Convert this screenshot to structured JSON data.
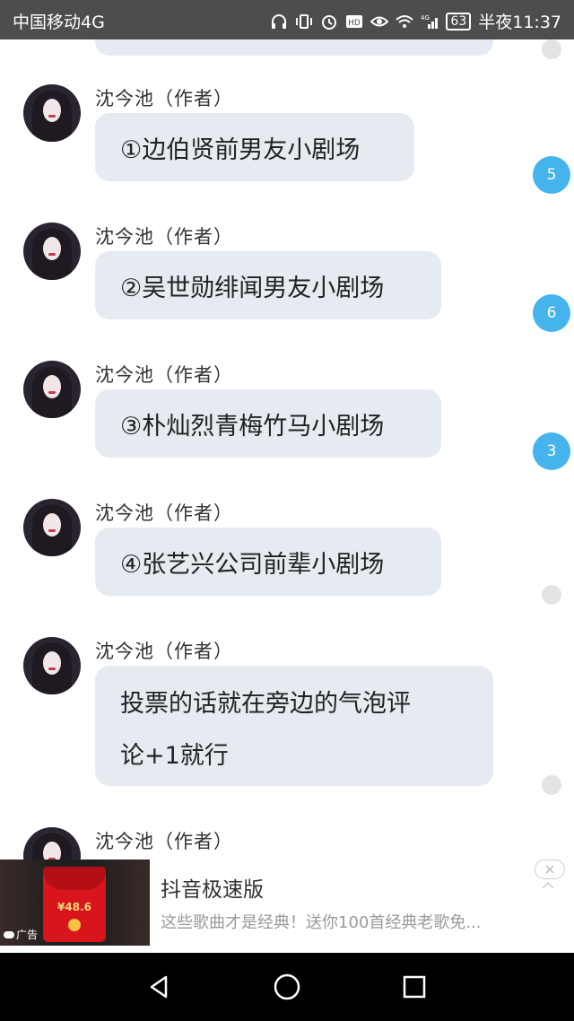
{
  "status_bar": {
    "carrier": "中国移动4G",
    "battery": "63",
    "time": "半夜11:37",
    "network": "4G"
  },
  "messages": [
    {
      "name": "沈今池（作者）",
      "text": "①边伯贤前男友小剧场",
      "comment_count": "5"
    },
    {
      "name": "沈今池（作者）",
      "text": "②吴世勋绯闻男友小剧场",
      "comment_count": "6"
    },
    {
      "name": "沈今池（作者）",
      "text": "③朴灿烈青梅竹马小剧场",
      "comment_count": "3"
    },
    {
      "name": "沈今池（作者）",
      "text": "④张艺兴公司前辈小剧场",
      "comment_count": ""
    },
    {
      "name": "沈今池（作者）",
      "text_line1": "投票的话就在旁边的气泡评",
      "text_line2": "论+1就行",
      "comment_count": ""
    },
    {
      "name": "沈今池（作者）"
    }
  ],
  "ad": {
    "label": "广告",
    "title": "抖音极速版",
    "description": "这些歌曲才是经典！送你100首经典老歌免...",
    "thumb_amount": "¥48.6",
    "close_icon": "close-icon"
  },
  "nav": {
    "back": "back-triangle-icon",
    "home": "home-circle-icon",
    "recents": "recents-square-icon"
  },
  "colors": {
    "bubble": "#e6eaf1",
    "count_badge": "#45b4ec",
    "empty_dot": "#e3e3e3",
    "status_bar": "#4d4d4d"
  }
}
